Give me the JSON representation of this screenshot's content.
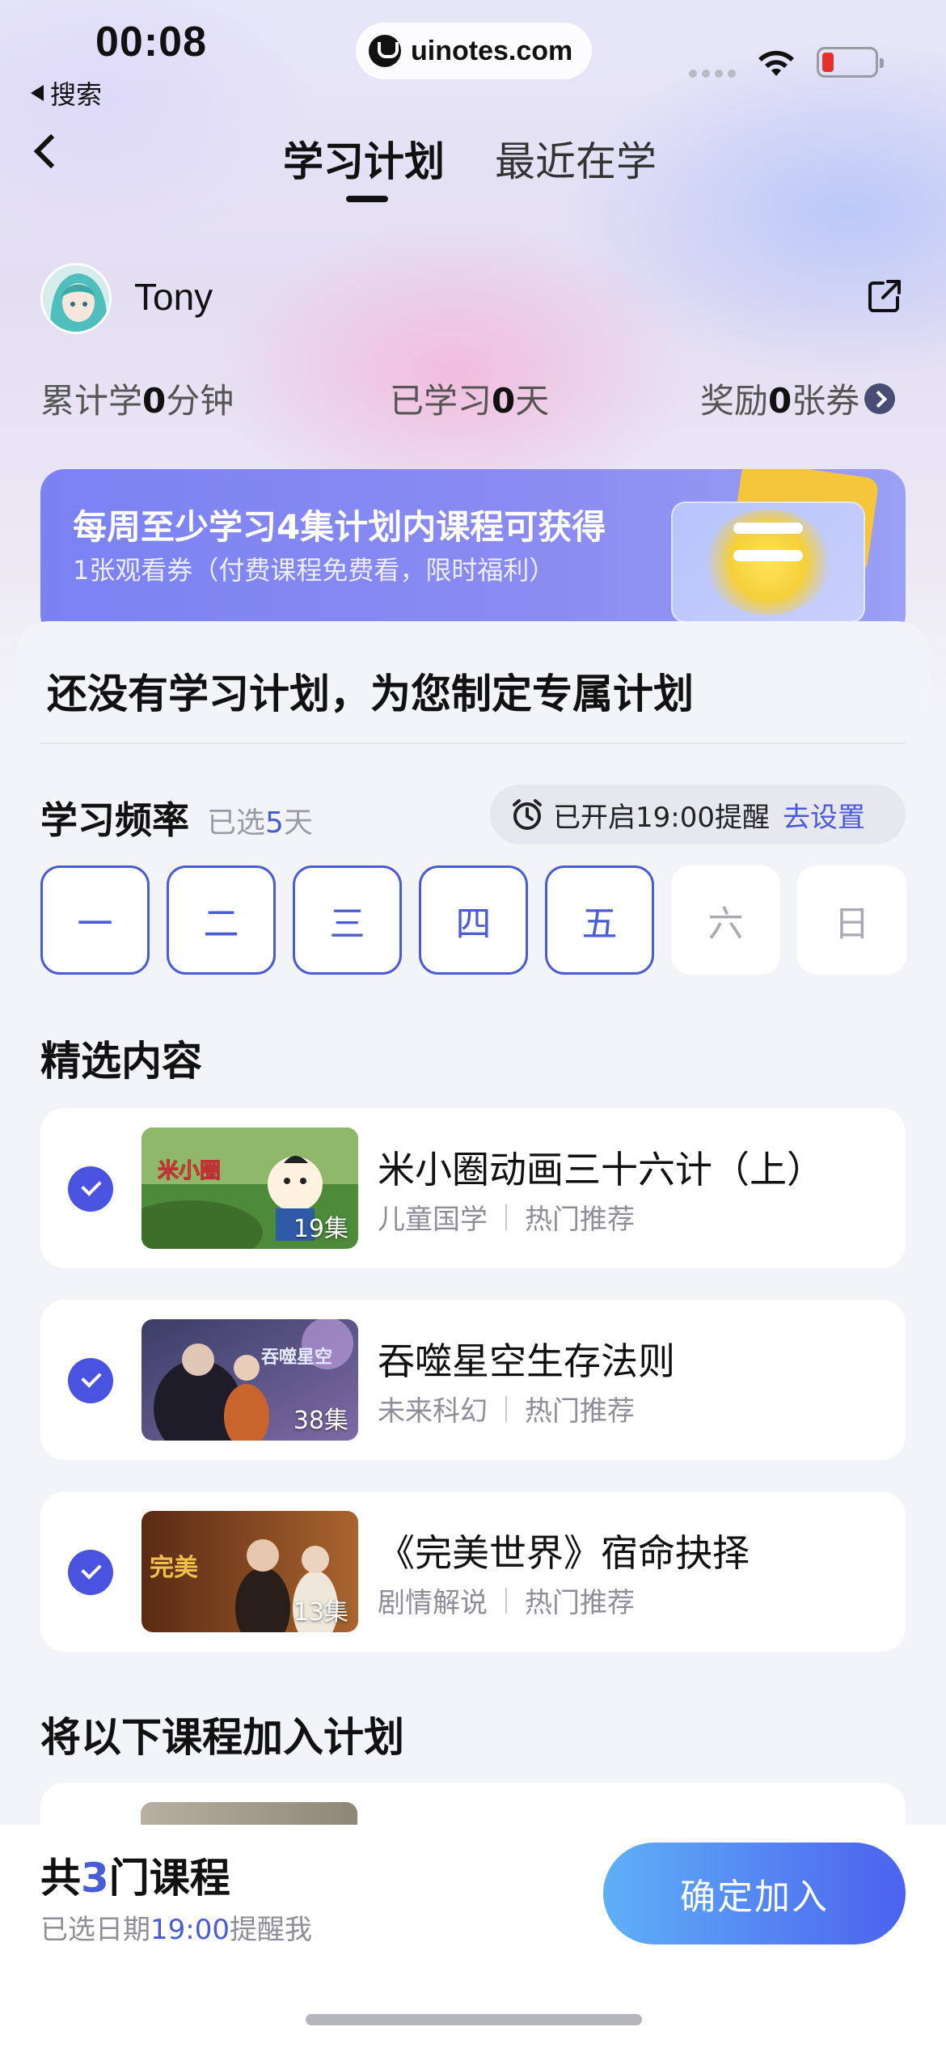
{
  "status_bar": {
    "time": "00:08",
    "back_app": "搜索",
    "url": "uinotes.com"
  },
  "nav": {
    "tabs": [
      {
        "label": "学习计划",
        "active": true
      },
      {
        "label": "最近在学",
        "active": false
      }
    ],
    "back_icon": "chevron-left-icon"
  },
  "profile": {
    "username": "Tony",
    "share_icon": "share-external-icon"
  },
  "stats": {
    "total_minutes": {
      "prefix": "累计学",
      "value": "0",
      "suffix": "分钟"
    },
    "days": {
      "prefix": "已学习",
      "value": "0",
      "suffix": "天"
    },
    "coupons": {
      "prefix": "奖励",
      "value": "0",
      "suffix": "张券"
    }
  },
  "banner": {
    "title": "每周至少学习4集计划内课程可获得",
    "subtitle": "1张观看券（付费课程免费看，限时福利）"
  },
  "plan": {
    "heading": "还没有学习计划，为您制定专属计划",
    "frequency_label": "学习频率",
    "selected_prefix": "已选",
    "selected_count": "5",
    "selected_suffix": "天",
    "reminder_text": "已开启19:00提醒",
    "reminder_link": "去设置",
    "days": [
      {
        "label": "一",
        "selected": true
      },
      {
        "label": "二",
        "selected": true
      },
      {
        "label": "三",
        "selected": true
      },
      {
        "label": "四",
        "selected": true
      },
      {
        "label": "五",
        "selected": true
      },
      {
        "label": "六",
        "selected": false
      },
      {
        "label": "日",
        "selected": false
      }
    ]
  },
  "featured": {
    "heading": "精选内容",
    "courses": [
      {
        "title": "米小圈动画三十六计（上）",
        "category": "儿童国学",
        "tag": "热门推荐",
        "episodes": "19集",
        "checked": true
      },
      {
        "title": "吞噬星空生存法则",
        "category": "未来科幻",
        "tag": "热门推荐",
        "episodes": "38集",
        "checked": true
      },
      {
        "title": "《完美世界》宿命抉择",
        "category": "剧情解说",
        "tag": "热门推荐",
        "episodes": "13集",
        "checked": true
      }
    ]
  },
  "add_section": {
    "heading": "将以下课程加入计划"
  },
  "bottom_bar": {
    "total_prefix": "共",
    "total_count": "3",
    "total_suffix": "门课程",
    "date_prefix": "已选日期",
    "date_time": "19:00",
    "date_suffix": "提醒我",
    "confirm_label": "确定加入"
  },
  "colors": {
    "accent": "#4a5bd8",
    "check": "#4a52e0",
    "button_start": "#5fb0f7",
    "button_end": "#4b62ee"
  }
}
